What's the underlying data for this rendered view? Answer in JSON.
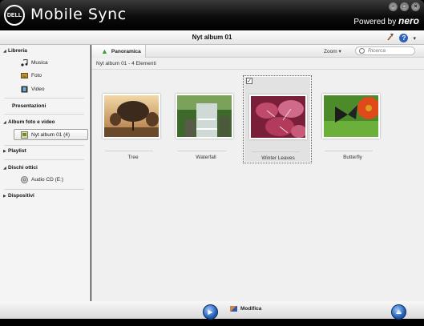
{
  "window": {
    "logo_text": "DELL",
    "title": "Mobile Sync",
    "powered_prefix": "Powered by",
    "powered_brand": "nero",
    "controls": [
      "–",
      "□",
      "×"
    ]
  },
  "header": {
    "title": "Nyt album 01",
    "help_label": "?",
    "help_menu_arrow": "▾"
  },
  "sidebar": {
    "libreria": {
      "title": "Libreria",
      "items": [
        {
          "label": "Musica",
          "icon": "music-note-icon"
        },
        {
          "label": "Foto",
          "icon": "photo-icon"
        },
        {
          "label": "Video",
          "icon": "film-icon"
        }
      ]
    },
    "presentazioni": {
      "title": "Presentazioni"
    },
    "album": {
      "title": "Album foto e video",
      "selected_item": "Nyt album 01 (4)"
    },
    "playlist": {
      "title": "Playlist"
    },
    "dischi": {
      "title": "Dischi ottici",
      "items": [
        {
          "label": "Audio CD (E:)",
          "icon": "cd-icon"
        }
      ]
    },
    "dispositivi": {
      "title": "Dispositivi"
    }
  },
  "toolbar": {
    "tab_label": "Panoramica",
    "zoom_label": "Zoom",
    "zoom_arrow": "▾",
    "search_placeholder": "Ricerca"
  },
  "content": {
    "subheader": "Nyt album 01 - 4  Elementi",
    "thumbnails": [
      {
        "label": "Tree",
        "selected": false
      },
      {
        "label": "Waterfall",
        "selected": false
      },
      {
        "label": "Winter Leaves",
        "selected": true,
        "checked_mark": "✓"
      },
      {
        "label": "Butterfly",
        "selected": false
      }
    ]
  },
  "bottom": {
    "play_symbol": "▶",
    "edit_label": "Modifica",
    "eject_symbol": "⏏"
  },
  "colors": {
    "accent_blue": "#2460b4",
    "titlebar": "#0c0c0c"
  }
}
